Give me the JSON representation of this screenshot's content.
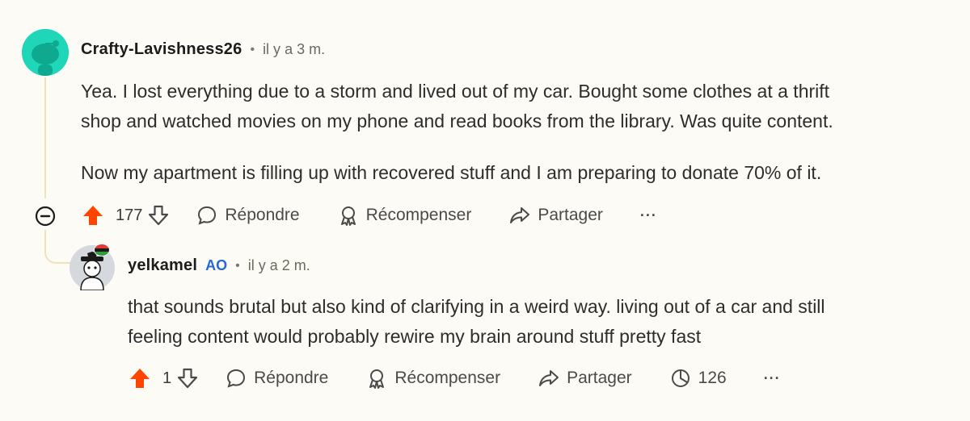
{
  "comment1": {
    "username": "Crafty-Lavishness26",
    "separator": "•",
    "time": "il y a 3 m.",
    "paragraphs": [
      "Yea. I lost everything due to a storm and lived out of my car. Bought some clothes at a thrift",
      "shop and watched movies on my phone and read books from the library. Was quite content.",
      "Now my apartment is filling up with recovered stuff and I am preparing to donate 70% of it."
    ],
    "votes": "177",
    "reply_label": "Répondre",
    "award_label": "Récompenser",
    "share_label": "Partager",
    "more_label": "···"
  },
  "comment2": {
    "username": "yelkamel",
    "op_badge": "AO",
    "separator": "•",
    "time": "il y a 2 m.",
    "paragraphs": [
      "that sounds brutal but also kind of clarifying in a weird way. living out of a car and still",
      "feeling content would probably rewire my brain around stuff pretty fast"
    ],
    "votes": "1",
    "reply_label": "Répondre",
    "award_label": "Récompenser",
    "share_label": "Partager",
    "views": "126",
    "more_label": "···"
  },
  "colors": {
    "upvote": "#ff4500",
    "op_badge": "#2767d6",
    "thread_line": "#efe2b8",
    "avatar_bg": "#1fd6b8",
    "background": "#fcfbf5"
  }
}
